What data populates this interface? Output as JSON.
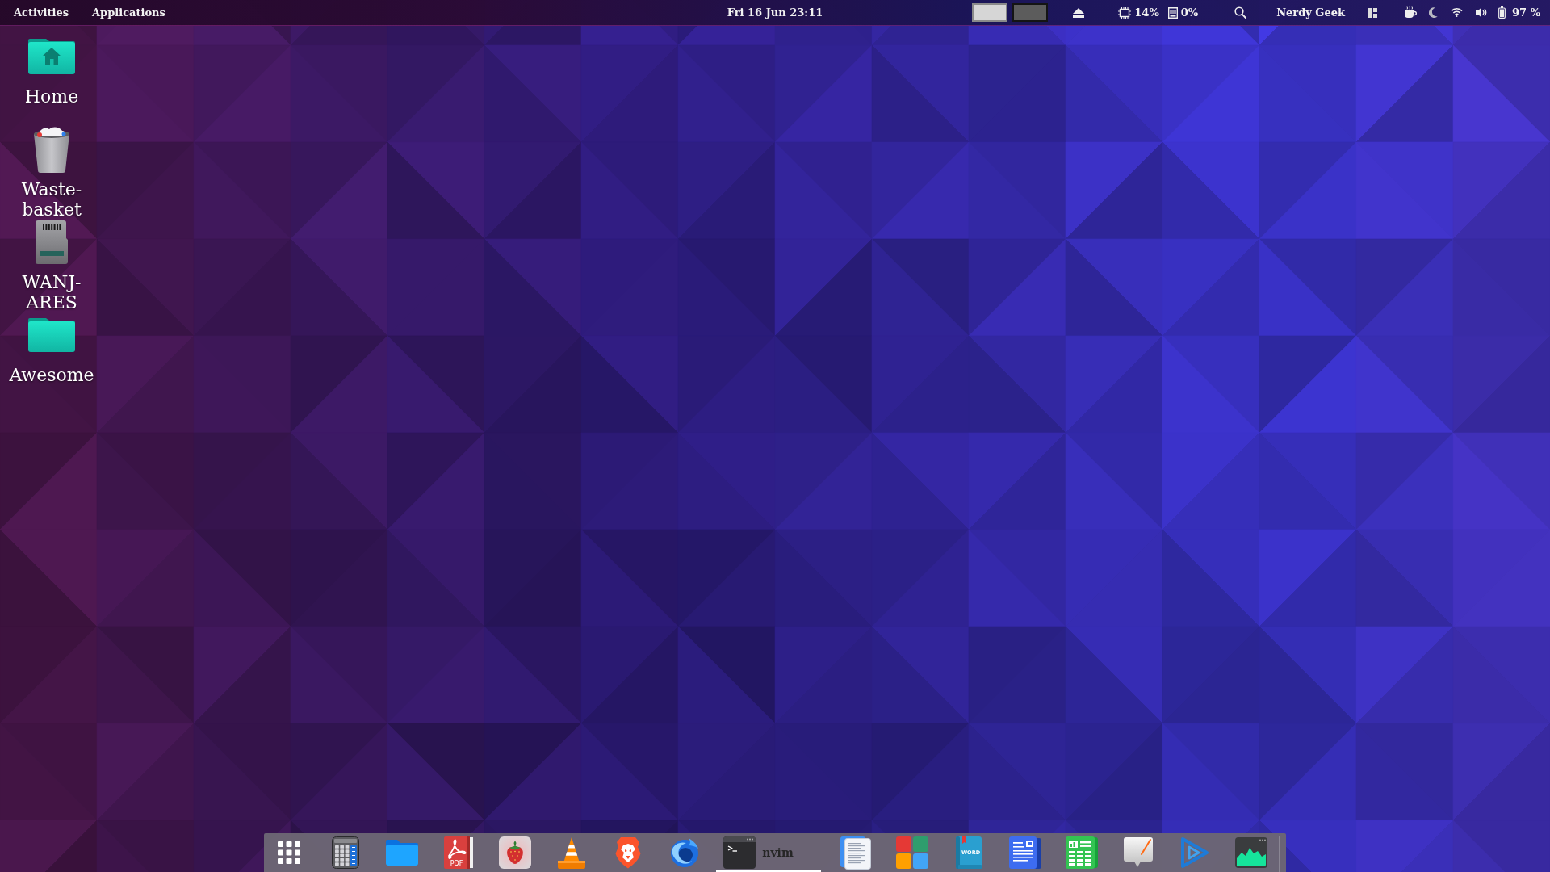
{
  "top_bar": {
    "menus": [
      "Activities",
      "Applications"
    ],
    "clock": "Fri 16 Jun 23:11",
    "workspaces": [
      {
        "selected": true
      },
      {
        "selected": false
      }
    ],
    "monitors": [
      {
        "kind": "cpu",
        "reading": "14%"
      },
      {
        "kind": "disk",
        "reading": "0%"
      }
    ],
    "user": "Nerdy Geek",
    "battery": "97 %"
  },
  "desktop_icons": [
    {
      "kind": "home-folder",
      "label": "Home"
    },
    {
      "kind": "trash",
      "label": "Waste-basket"
    },
    {
      "kind": "sd-card",
      "label": "WANJ-ARES"
    },
    {
      "kind": "folder",
      "label": "Awesome"
    }
  ],
  "dock": {
    "items": [
      {
        "kind": "app-grid",
        "selected": false
      },
      {
        "kind": "calculator",
        "selected": false
      },
      {
        "kind": "files",
        "selected": false
      },
      {
        "kind": "pdf",
        "icon_text": "PDF",
        "selected": false
      },
      {
        "kind": "strawberry",
        "selected": false
      },
      {
        "kind": "cone",
        "selected": false
      },
      {
        "kind": "lion",
        "selected": false
      },
      {
        "kind": "bird",
        "selected": false
      },
      {
        "kind": "terminal",
        "label": "nvim",
        "selected": true
      },
      {
        "kind": "text-editor",
        "selected": false
      },
      {
        "kind": "squares",
        "selected": false
      },
      {
        "kind": "book",
        "icon_text": "WORD",
        "selected": false
      },
      {
        "kind": "newspaper",
        "selected": false
      },
      {
        "kind": "spreadsheet",
        "selected": false
      },
      {
        "kind": "bubble",
        "selected": false
      },
      {
        "kind": "play",
        "selected": false
      },
      {
        "kind": "monitor",
        "selected": false
      }
    ]
  }
}
